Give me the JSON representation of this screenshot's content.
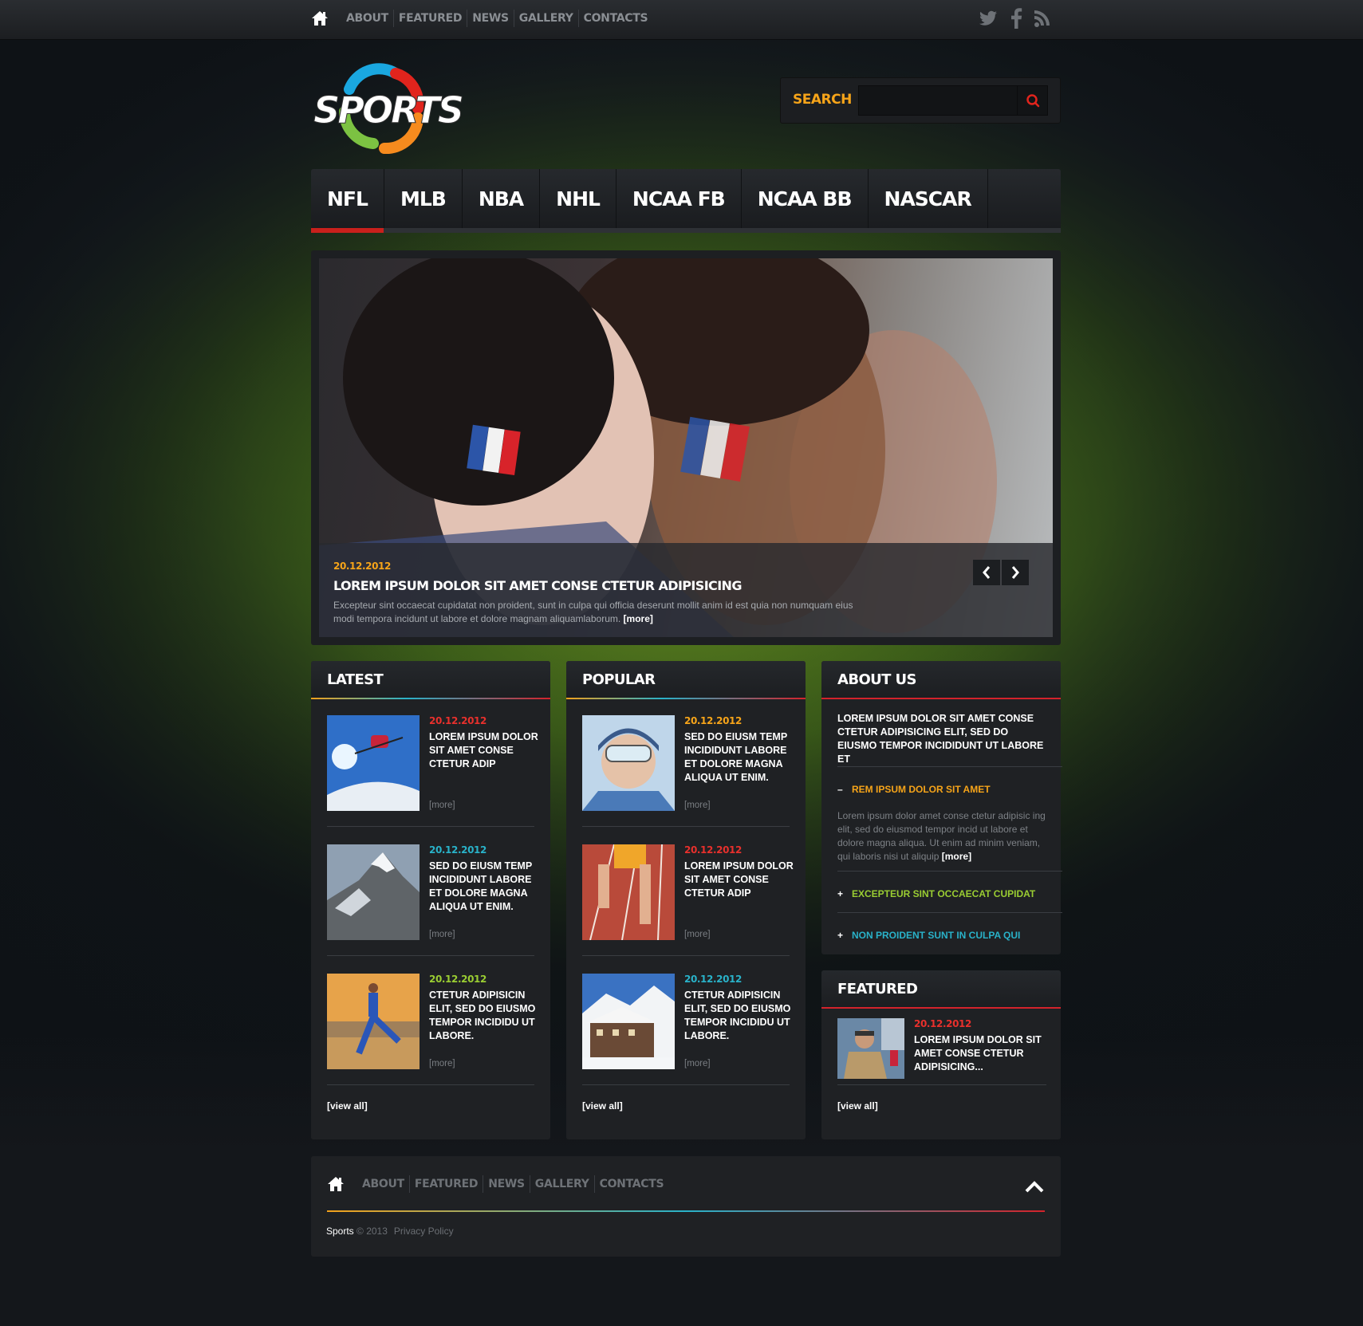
{
  "colors": {
    "accent_orange": "#f6a419",
    "accent_red": "#c9201c",
    "accent_cyan": "#29b2c9",
    "accent_green": "#9acd32",
    "panel_bg": "#1f2124"
  },
  "topbar": {
    "home_icon": "home-icon",
    "nav": [
      "ABOUT",
      "FEATURED",
      "NEWS",
      "GALLERY",
      "CONTACTS"
    ],
    "social_icons": [
      "twitter-icon",
      "facebook-icon",
      "rss-icon"
    ]
  },
  "logo": {
    "text": "SPORTS"
  },
  "search": {
    "label": "SEARCH",
    "value": "",
    "placeholder": ""
  },
  "main_nav": {
    "tabs": [
      "NFL",
      "MLB",
      "NBA",
      "NHL",
      "NCAA FB",
      "NCAA BB",
      "NASCAR"
    ],
    "active": "NFL"
  },
  "slider": {
    "date": "20.12.2012",
    "title": "LOREM IPSUM DOLOR SIT AMET CONSE CTETUR ADIPISICING",
    "text": "Excepteur sint occaecat cupidatat non proident, sunt in culpa qui officia deserunt mollit anim id est  quia non numquam eius modi tempora incidunt ut labore et dolore magnam aliquamlaborum.",
    "more": "[more]"
  },
  "latest": {
    "heading": "LATEST",
    "posts": [
      {
        "date": "20.12.2012",
        "title": "LOREM IPSUM DOLOR SIT AMET CONSE CTETUR ADIP",
        "more": "[more]",
        "date_color": "#e8302c",
        "thumb": "skier-jump"
      },
      {
        "date": "20.12.2012",
        "title": "SED DO EIUSM TEMP INCIDIDUNT LABORE ET DOLORE MAGNA ALIQUA UT ENIM.",
        "more": "[more]",
        "date_color": "#29b2c9",
        "thumb": "mountain-peak"
      },
      {
        "date": "20.12.2012",
        "title": "CTETUR ADIPISICIN ELIT, SED DO EIUSMO TEMPOR INCIDIDU UT LABORE.",
        "more": "[more]",
        "date_color": "#9acd32",
        "thumb": "runner-beach"
      }
    ],
    "view_all": "[view all]"
  },
  "popular": {
    "heading": "POPULAR",
    "posts": [
      {
        "date": "20.12.2012",
        "title": "SED DO EIUSM TEMP INCIDIDUNT LABORE ET DOLORE MAGNA ALIQUA UT ENIM.",
        "more": "[more]",
        "date_color": "#f6a419",
        "thumb": "skier-goggles"
      },
      {
        "date": "20.12.2012",
        "title": "LOREM IPSUM DOLOR SIT AMET CONSE CTETUR ADIP",
        "more": "[more]",
        "date_color": "#e8302c",
        "thumb": "track-runner"
      },
      {
        "date": "20.12.2012",
        "title": "CTETUR ADIPISICIN ELIT, SED DO EIUSMO TEMPOR INCIDIDU UT LABORE.",
        "more": "[more]",
        "date_color": "#29b2c9",
        "thumb": "ski-lodge"
      }
    ],
    "view_all": "[view all]"
  },
  "about": {
    "heading": "ABOUT US",
    "intro": "LOREM IPSUM DOLOR SIT AMET CONSE CTETUR ADIPISICING ELIT, SED DO EIUSMO TEMPOR INCIDIDUNT UT LABORE ET",
    "items": [
      {
        "symbol": "–",
        "label": "REM IPSUM DOLOR SIT AMET",
        "color": "#f6a419",
        "expanded": true,
        "body": "Lorem ipsum dolor amet conse ctetur adipisic ing elit, sed do eiusmod tempor incid ut labore et dolore magna aliqua. Ut enim ad minim veniam, qui laboris nisi ut aliquip",
        "more": "[more]"
      },
      {
        "symbol": "+",
        "label": "EXCEPTEUR SINT OCCAECAT CUPIDAT",
        "color": "#9acd32",
        "expanded": false
      },
      {
        "symbol": "+",
        "label": "NON PROIDENT SUNT IN CULPA QUI",
        "color": "#29b2c9",
        "expanded": false
      }
    ]
  },
  "featured": {
    "heading": "FEATURED",
    "post": {
      "date": "20.12.2012",
      "title": "LOREM IPSUM DOLOR SIT AMET CONSE CTETUR ADIPISICING...",
      "date_color": "#e8302c",
      "thumb": "climber-portrait"
    },
    "view_all": "[view all]"
  },
  "footer": {
    "nav": [
      "ABOUT",
      "FEATURED",
      "NEWS",
      "GALLERY",
      "CONTACTS"
    ],
    "brand": "Sports",
    "copyright": " © 2013",
    "privacy": "Privacy Policy"
  }
}
